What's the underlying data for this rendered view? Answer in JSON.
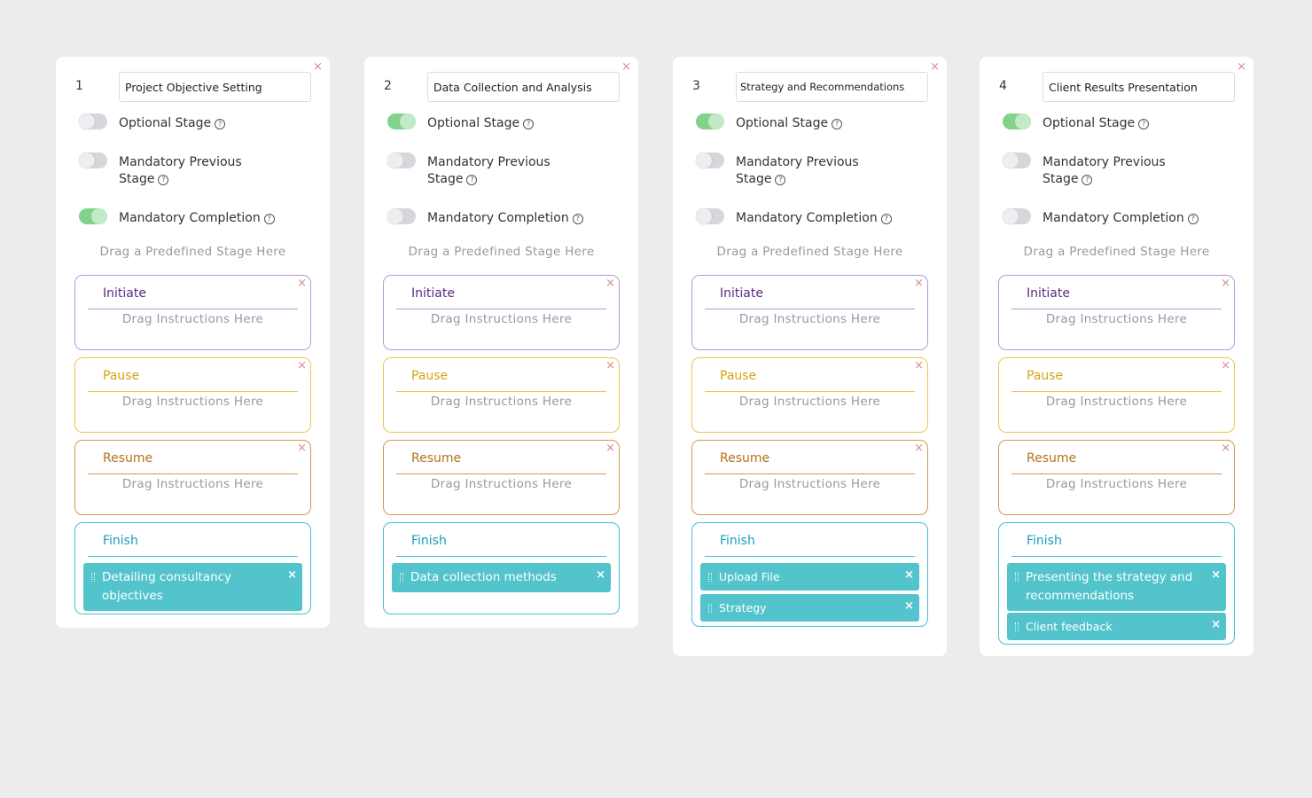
{
  "common": {
    "close_glyph": "×",
    "help_glyph": "?",
    "optional_label": "Optional Stage",
    "mandatory_prev_label": "Mandatory Previous Stage",
    "mandatory_completion_label": "Mandatory Completion",
    "drag_stage_hint": "Drag a Predefined Stage Here",
    "drag_instructions_hint": "Drag Instructions Here",
    "sections": {
      "initiate": "Initiate",
      "pause": "Pause",
      "resume": "Resume",
      "finish": "Finish"
    }
  },
  "colors": {
    "toggle_on": "#82d28c",
    "toggle_off": "#d6d7dc",
    "initiate": "#5b2a82",
    "pause": "#d4a612",
    "resume": "#b6711d",
    "finish": "#1a9cbf",
    "chip": "#54c4cc",
    "close": "#d98b86"
  },
  "stages": [
    {
      "number": "1",
      "name": "Project Objective Setting",
      "optional": false,
      "mandatory_previous": false,
      "mandatory_completion": true,
      "finish_items": [
        "Detailing consultancy objectives"
      ]
    },
    {
      "number": "2",
      "name": "Data Collection and Analysis",
      "optional": true,
      "mandatory_previous": false,
      "mandatory_completion": false,
      "finish_items": [
        "Data collection methods"
      ]
    },
    {
      "number": "3",
      "name": "Strategy and Recommendations",
      "optional": true,
      "mandatory_previous": false,
      "mandatory_completion": false,
      "finish_items": [
        "Upload File",
        "Strategy"
      ]
    },
    {
      "number": "4",
      "name": "Client Results Presentation",
      "optional": true,
      "mandatory_previous": false,
      "mandatory_completion": false,
      "finish_items": [
        "Presenting the strategy and recommendations",
        "Client feedback"
      ]
    }
  ]
}
